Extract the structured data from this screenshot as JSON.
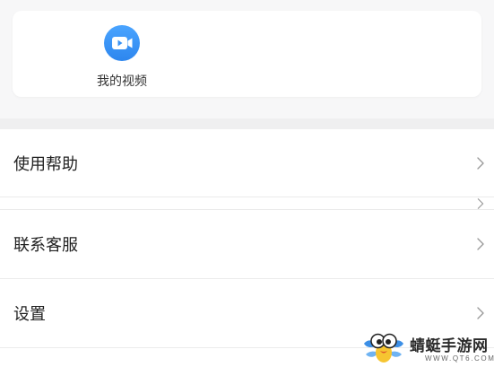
{
  "card": {
    "items": [
      {
        "label": "我的视频",
        "icon": "video-camera-icon"
      }
    ]
  },
  "menu": {
    "items": [
      {
        "label": "使用帮助",
        "icon": "chevron-right-icon"
      },
      {
        "icon": "chevron-right-icon"
      },
      {
        "label": "联系客服",
        "icon": "chevron-right-icon"
      },
      {
        "label": "设置",
        "icon": "chevron-right-icon"
      }
    ]
  },
  "watermark": {
    "name": "蜻蜓手游网",
    "url": "WWW.QT6.COM"
  },
  "colors": {
    "accent": "#3a93f5",
    "page_background": "#f7f7f8",
    "text_primary": "#222222",
    "chevron": "#9a9a9a",
    "divider": "#ebebeb"
  }
}
